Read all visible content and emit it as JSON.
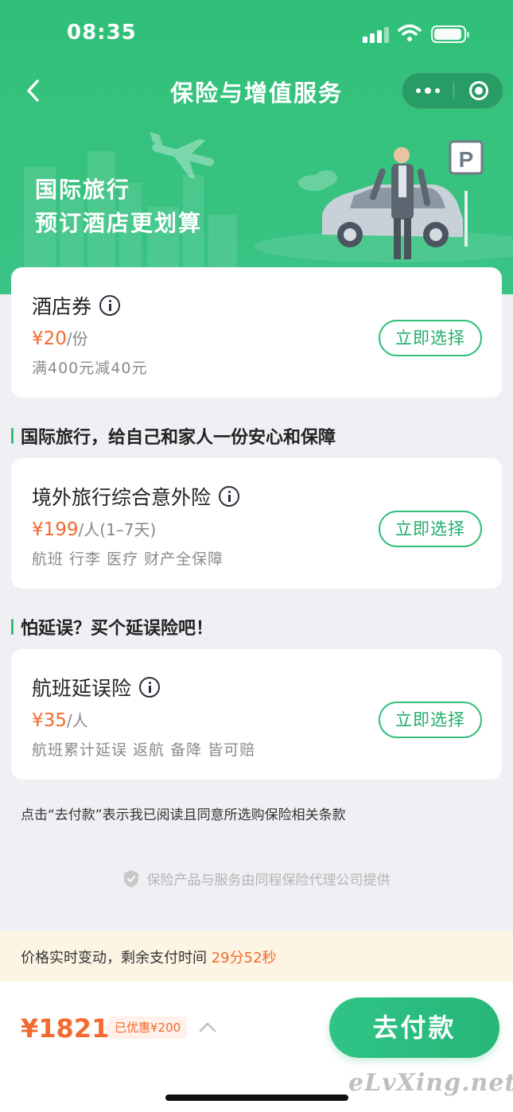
{
  "status_bar": {
    "time": "08:35"
  },
  "nav": {
    "title": "保险与增值服务"
  },
  "banner": {
    "line1": "国际旅行",
    "line2": "预订酒店更划算",
    "parking_sign": "P"
  },
  "cards": [
    {
      "title": "酒店券",
      "price": "¥20",
      "unit": "/份",
      "desc": "满400元减40元",
      "button": "立即选择"
    },
    {
      "title": "境外旅行综合意外险",
      "price": "¥199",
      "unit": "/人(1–7天)",
      "desc": "航班 行李 医疗 财产全保障",
      "button": "立即选择"
    },
    {
      "title": "航班延误险",
      "price": "¥35",
      "unit": "/人",
      "desc": "航班累计延误 返航 备降 皆可赔",
      "button": "立即选择"
    }
  ],
  "sections": {
    "travel": "国际旅行，给自己和家人一份安心和保障",
    "delay": "怕延误？买个延误险吧！"
  },
  "terms": "点击“去付款”表示我已阅读且同意所选购保险相关条款",
  "provider": "保险产品与服务由同程保险代理公司提供",
  "countdown": {
    "label": "价格实时变动，剩余支付时间 ",
    "time": "29分52秒"
  },
  "bottom": {
    "total": "¥1821",
    "discount": "已优惠¥200",
    "pay": "去付款",
    "watermark": "eLvXing.net"
  },
  "colors": {
    "brand_green": "#2fbf78",
    "price_orange": "#f26a2e",
    "countdown_bg": "#fdf5e4"
  }
}
